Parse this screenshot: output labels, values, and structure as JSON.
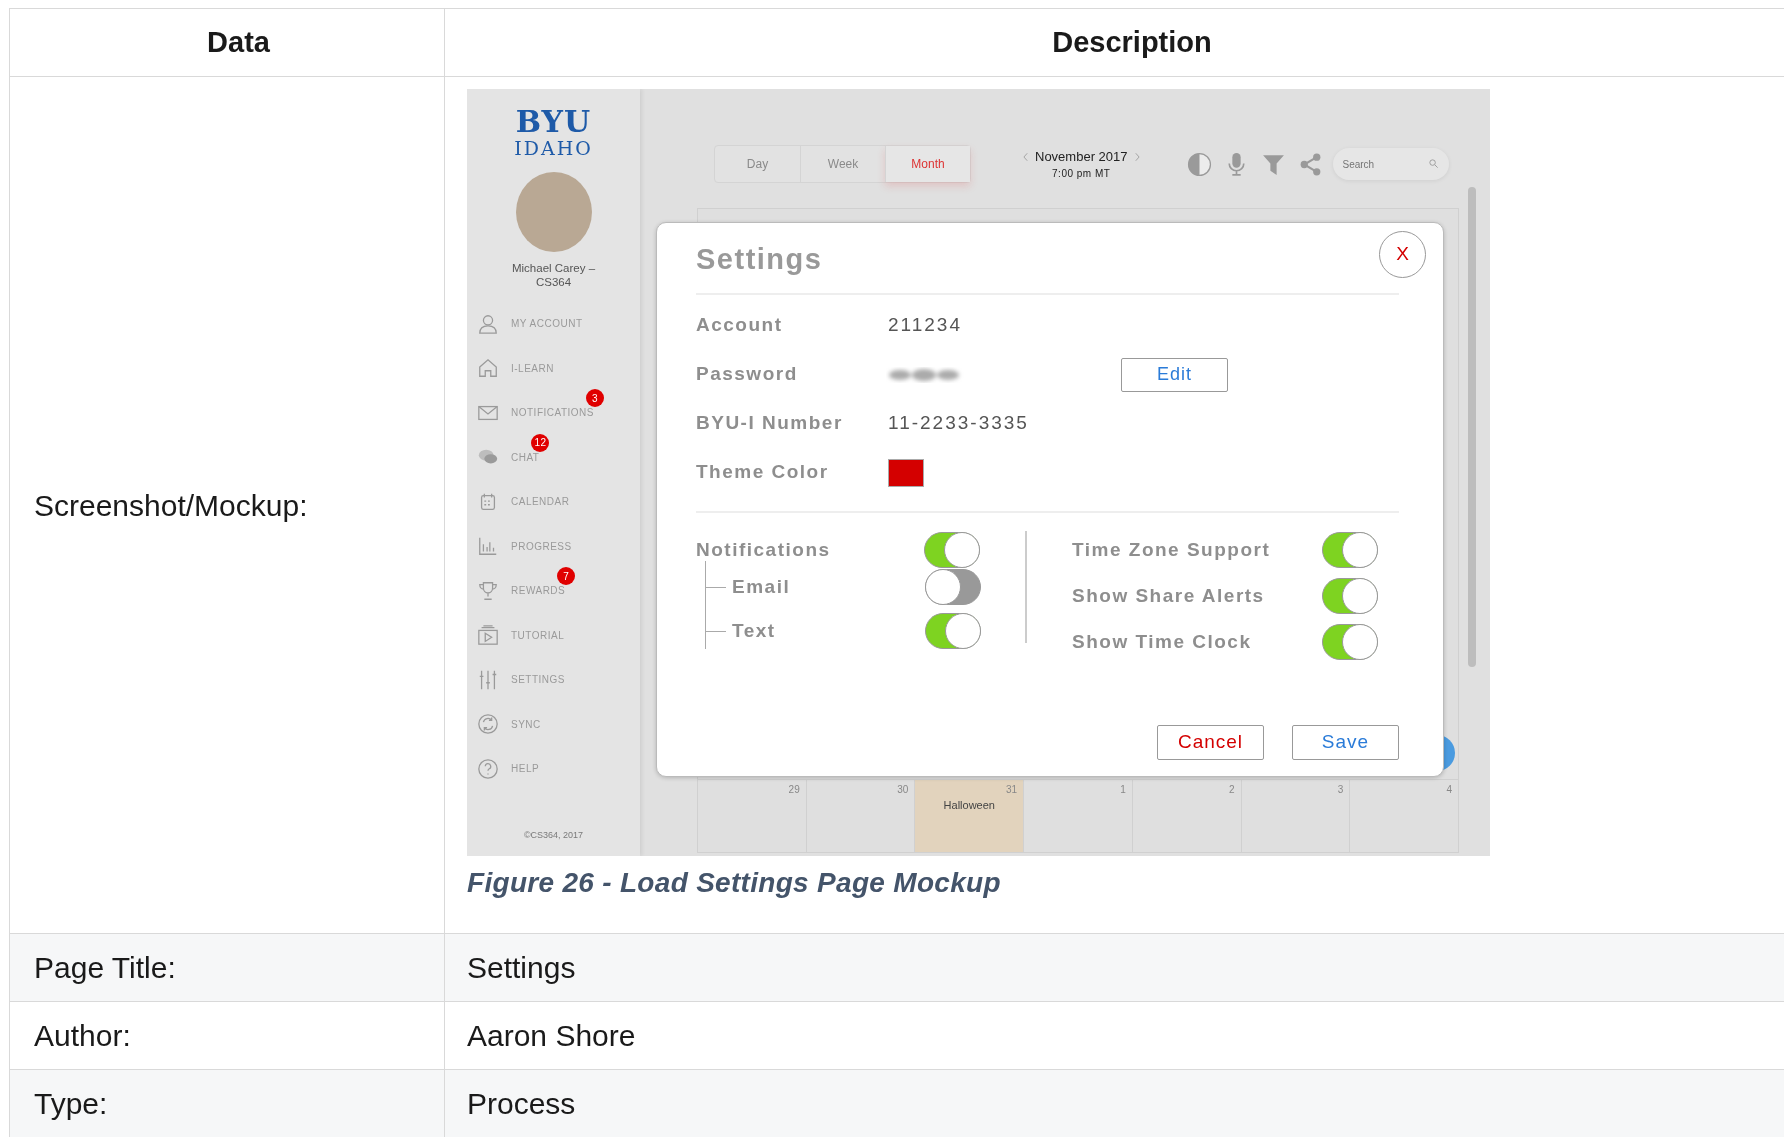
{
  "table": {
    "columns": [
      "Data",
      "Description"
    ]
  },
  "mockup_row": {
    "label": "Screenshot/Mockup:",
    "caption": "Figure 26 - Load Settings Page Mockup"
  },
  "app": {
    "logo": {
      "line_1": "BYU",
      "line_2": "IDAHO"
    },
    "user_name": "Michael Carey – CS364",
    "nav": [
      {
        "label": "MY ACCOUNT"
      },
      {
        "label": "I-LEARN"
      },
      {
        "label": "NOTIFICATIONS",
        "badge": "3"
      },
      {
        "label": "CHAT",
        "badge": "12"
      },
      {
        "label": "CALENDAR"
      },
      {
        "label": "PROGRESS"
      },
      {
        "label": "REWARDS",
        "badge": "7"
      },
      {
        "label": "TUTORIAL"
      },
      {
        "label": "SETTINGS"
      },
      {
        "label": "SYNC"
      },
      {
        "label": "HELP"
      }
    ],
    "footer": "©CS364, 2017",
    "view_tabs": [
      {
        "label": "Day",
        "selected": false
      },
      {
        "label": "Week",
        "selected": false
      },
      {
        "label": "Month",
        "selected": true
      }
    ],
    "month": "November 2017",
    "time": "7:00 pm MT",
    "search": {
      "placeholder": "Search"
    },
    "calendar_days": [
      {
        "date": "29"
      },
      {
        "date": "30"
      },
      {
        "date": "31",
        "event": "Halloween"
      },
      {
        "date": "1"
      },
      {
        "date": "2"
      },
      {
        "date": "3"
      },
      {
        "date": "4"
      }
    ],
    "settings": {
      "title": "Settings",
      "close": "X",
      "fields": [
        {
          "kind": "text",
          "label": "Account",
          "value": "211234"
        },
        {
          "kind": "masked",
          "label": "Password",
          "button": "Edit"
        },
        {
          "kind": "text",
          "label": "BYU-I Number",
          "value": "11-2233-3335"
        },
        {
          "kind": "color",
          "label": "Theme Color",
          "color": "#d40000"
        }
      ],
      "left_toggles": [
        {
          "label": "Notifications",
          "on": true,
          "children": [
            {
              "label": "Email",
              "on": false
            },
            {
              "label": "Text",
              "on": true
            }
          ]
        }
      ],
      "right_toggles": [
        {
          "label": "Time Zone Support",
          "on": true
        },
        {
          "label": "Show Share Alerts",
          "on": true
        },
        {
          "label": "Show Time Clock",
          "on": true
        }
      ],
      "buttons": [
        {
          "kind": "cancel",
          "label": "Cancel"
        },
        {
          "kind": "save",
          "label": "Save"
        }
      ]
    }
  },
  "rows": [
    {
      "label": "Page Title:",
      "value": "Settings"
    },
    {
      "label": "Author:",
      "value": "Aaron Shore"
    },
    {
      "label": "Type:",
      "value": "Process"
    }
  ]
}
